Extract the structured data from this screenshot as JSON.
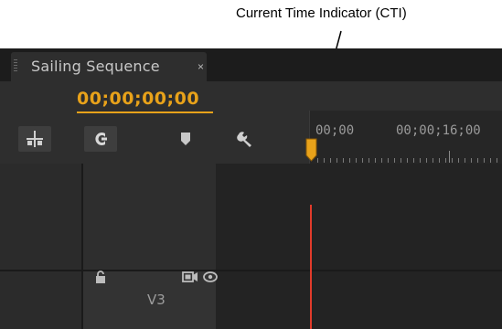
{
  "annotation": {
    "text": "Current Time Indicator (CTI)"
  },
  "panel": {
    "tab_title": "Sailing Sequence",
    "tab_close": "×"
  },
  "timecode": "00;00;00;00",
  "ruler": {
    "labels": [
      {
        "text": "00;00"
      },
      {
        "text": "00;00;16;00"
      }
    ]
  },
  "tools": [
    {
      "icon": "insert-edit-icon"
    },
    {
      "icon": "snap-icon"
    },
    {
      "icon": "add-marker-icon"
    },
    {
      "icon": "wrench-icon"
    }
  ],
  "tracks": [
    {
      "name": "V3",
      "icons": [
        "lock-icon",
        "camera-toggle-icon",
        "eye-icon"
      ]
    }
  ],
  "colors": {
    "timecode": "#e8a21a",
    "cti_line": "#e23b2b",
    "cti_head": "#e8a21a"
  }
}
